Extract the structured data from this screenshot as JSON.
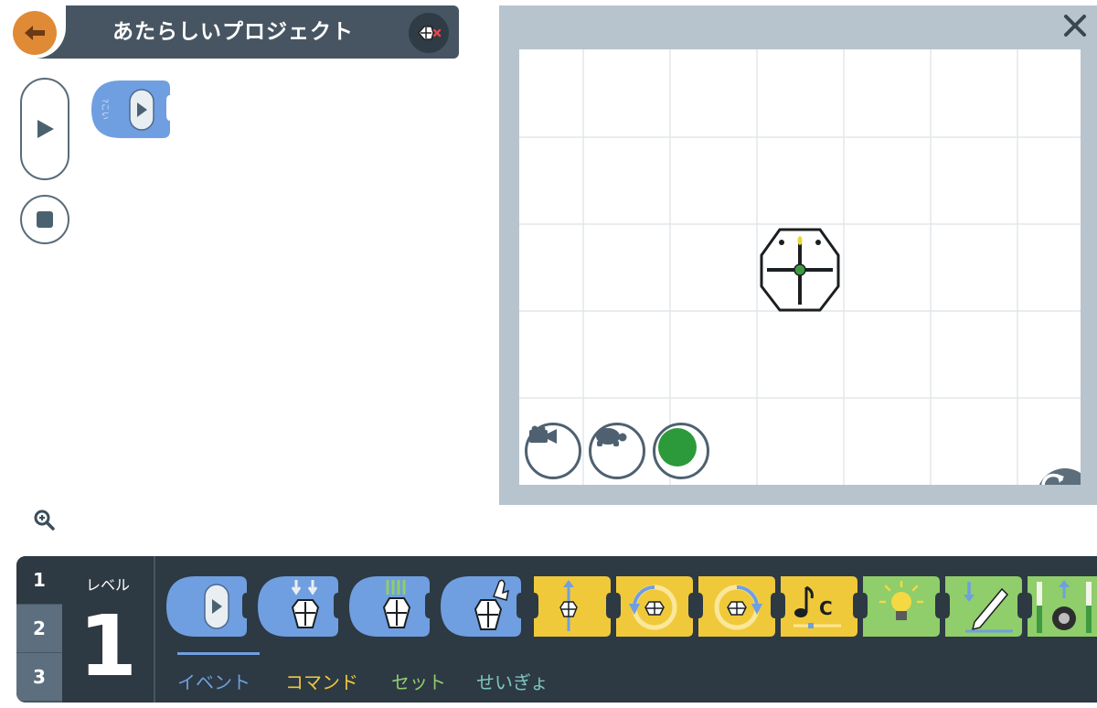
{
  "app": {
    "title": "あたらしいプロジェクト"
  },
  "icons": {
    "back": "arrow-left-icon",
    "robot_disconnect": "robot-disconnect-icon",
    "run": "play-icon",
    "stop": "stop-icon",
    "zoom": "zoom-in-icon",
    "close": "close-icon",
    "camera": "camera-icon",
    "speed": "turtle-icon",
    "status": "green-dot-icon",
    "reset": "reset-icon"
  },
  "palette": {
    "levels": [
      "1",
      "2",
      "3"
    ],
    "level_label": "レベル",
    "current_level": "1",
    "tabs": [
      {
        "label": "イベント",
        "color": "#6f9fe0"
      },
      {
        "label": "コマンド",
        "color": "#f0c93a"
      },
      {
        "label": "セット",
        "color": "#8fce6a"
      },
      {
        "label": "せいぎょ",
        "color": "#7fc6c0"
      }
    ],
    "blocks": [
      {
        "name": "event-start-block",
        "category": "event",
        "icon": "play-icon"
      },
      {
        "name": "event-touch-block",
        "category": "event",
        "icon": "robot-touch-icon"
      },
      {
        "name": "event-bumper-block",
        "category": "event",
        "icon": "robot-bumper-icon"
      },
      {
        "name": "event-tap-block",
        "category": "event",
        "icon": "robot-tap-icon"
      },
      {
        "name": "move-forward-block",
        "category": "command",
        "icon": "move-forward-icon"
      },
      {
        "name": "turn-left-block",
        "category": "command",
        "icon": "turn-left-icon"
      },
      {
        "name": "turn-right-block",
        "category": "command",
        "icon": "turn-right-icon"
      },
      {
        "name": "play-note-block",
        "category": "command",
        "icon": "music-note-icon",
        "text": "C"
      },
      {
        "name": "light-block",
        "category": "set",
        "icon": "lightbulb-icon"
      },
      {
        "name": "pen-block",
        "category": "set",
        "icon": "pen-icon"
      },
      {
        "name": "wheel-speed-block",
        "category": "set",
        "icon": "wheel-icon"
      }
    ]
  },
  "colors": {
    "event": "#6f9fe0",
    "command": "#f0c93a",
    "set": "#8fce6a",
    "accent_orange": "#e08a36",
    "header": "#475562"
  }
}
